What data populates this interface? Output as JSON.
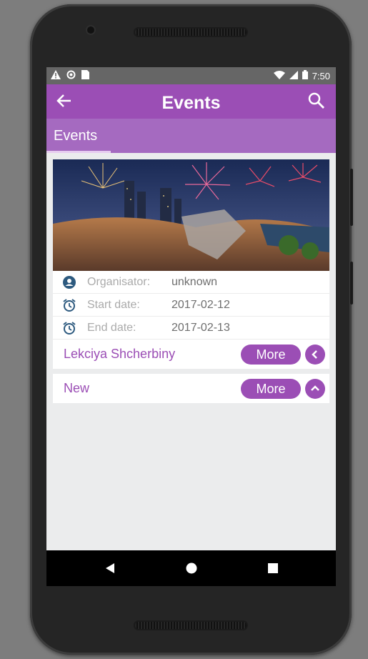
{
  "status_bar": {
    "time": "7:50",
    "icons": [
      "warning-icon",
      "circle-icon",
      "sim-icon",
      "wifi-icon",
      "signal-icon",
      "battery-icon"
    ]
  },
  "toolbar": {
    "title": "Events",
    "back_icon": "arrow-back-icon",
    "search_icon": "search-icon"
  },
  "tabs": [
    {
      "label": "Events",
      "active": true
    }
  ],
  "events": [
    {
      "name": "Lekciya Shcherbiny",
      "expanded": true,
      "image": "fireworks city banner",
      "details": [
        {
          "icon": "person-icon",
          "label": "Organisator:",
          "value": "unknown"
        },
        {
          "icon": "alarm-icon",
          "label": "Start date:",
          "value": "2017-02-12"
        },
        {
          "icon": "alarm-icon",
          "label": "End date:",
          "value": "2017-02-13"
        }
      ],
      "more_label": "More",
      "toggle_icon": "chevron-left-icon"
    },
    {
      "name": "New",
      "expanded": false,
      "more_label": "More",
      "toggle_icon": "chevron-up-icon"
    }
  ],
  "nav_bar": [
    "back-triangle-icon",
    "home-circle-icon",
    "recents-square-icon"
  ],
  "colors": {
    "primary": "#9b4eb5",
    "tab_bar": "#a56ac0",
    "status_bar": "#666666",
    "background": "#ebeced"
  }
}
